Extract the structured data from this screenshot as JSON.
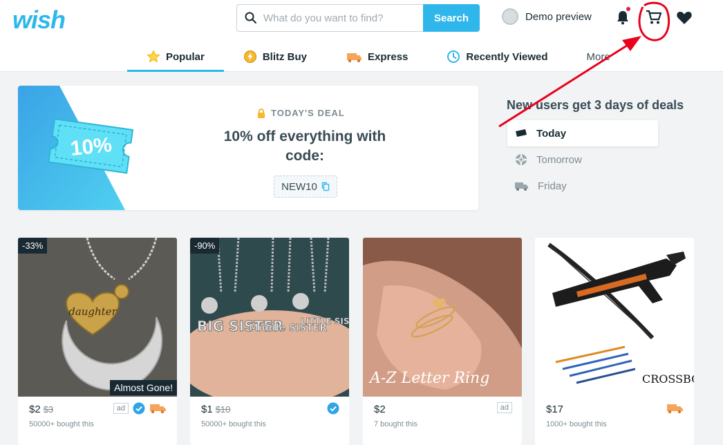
{
  "header": {
    "logo": "wish",
    "search": {
      "placeholder": "What do you want to find?",
      "button_label": "Search"
    },
    "user_name": "Demo preview"
  },
  "tabs": [
    {
      "label": "Popular",
      "icon": "star-icon"
    },
    {
      "label": "Blitz Buy",
      "icon": "blitz-icon"
    },
    {
      "label": "Express",
      "icon": "express-icon"
    },
    {
      "label": "Recently Viewed",
      "icon": "clock-icon"
    },
    {
      "label": "More"
    }
  ],
  "deal": {
    "label": "TODAY'S DEAL",
    "badge": "10%",
    "title": "10% off everything with code:",
    "code": "NEW10"
  },
  "side": {
    "title": "New users get 3 days of deals",
    "days": [
      {
        "label": "Today",
        "icon": "ticket-icon"
      },
      {
        "label": "Tomorrow",
        "icon": "aperture-icon"
      },
      {
        "label": "Friday",
        "icon": "truck-icon"
      }
    ]
  },
  "products": [
    {
      "discount": "-33%",
      "flag": "Almost Gone!",
      "price": "$2",
      "old_price": "$3",
      "bought": "50000+ bought this",
      "ad": "ad",
      "verified": true,
      "express": true
    },
    {
      "discount": "-90%",
      "flag": "",
      "price": "$1",
      "old_price": "$10",
      "bought": "50000+ bought this",
      "ad": "",
      "verified": true,
      "express": false
    },
    {
      "discount": "",
      "flag": "",
      "price": "$2",
      "old_price": "",
      "bought": "7 bought this",
      "ad": "ad",
      "verified": false,
      "express": false
    },
    {
      "discount": "",
      "flag": "",
      "price": "$17",
      "old_price": "",
      "bought": "1000+ bought this",
      "ad": "",
      "verified": false,
      "express": true
    }
  ],
  "product_images": {
    "p1_text": "daughter",
    "p2_text": [
      "BIG SISTER",
      "Middle SISTER",
      "LITTLE SISTER"
    ],
    "p3_text": "A-Z Letter Ring",
    "p4_text": "CROSSBOW"
  },
  "colors": {
    "accent": "#2fb7ec",
    "text": "#192a32",
    "annotation": "#e8001c"
  }
}
